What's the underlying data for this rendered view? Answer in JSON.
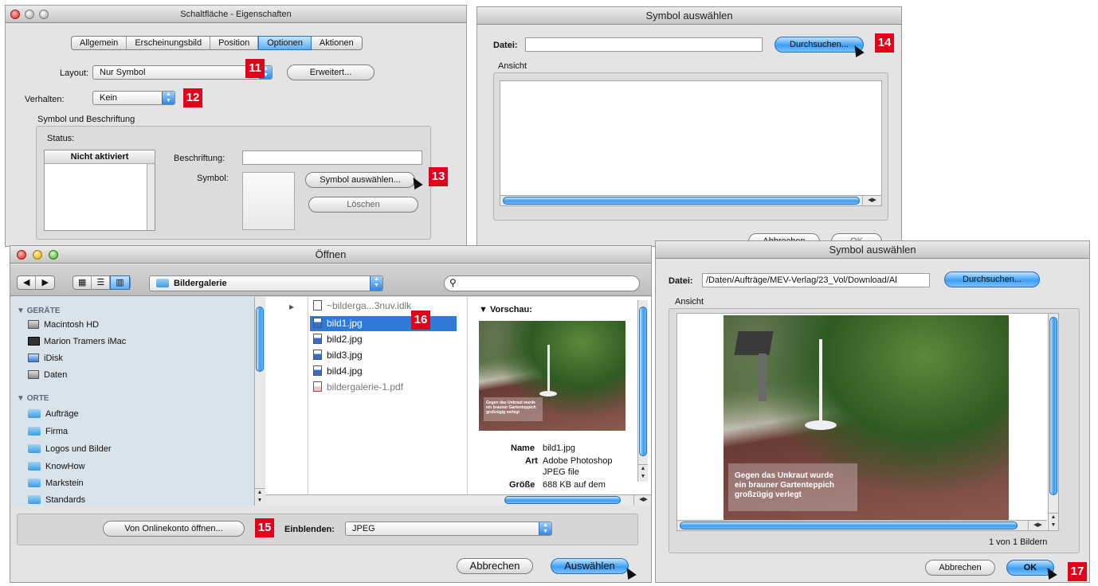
{
  "win_props": {
    "title": "Schaltfläche - Eigenschaften",
    "tabs": [
      "Allgemein",
      "Erscheinungsbild",
      "Position",
      "Optionen",
      "Aktionen"
    ],
    "selected_tab": "Optionen",
    "layout_label": "Layout:",
    "layout_value": "Nur Symbol",
    "erweitert_button": "Erweitert...",
    "verhalten_label": "Verhalten:",
    "verhalten_value": "Kein",
    "group_label": "Symbol und Beschriftung",
    "status_label": "Status:",
    "status_header": "Nicht aktiviert",
    "beschriftung_label": "Beschriftung:",
    "symbol_label": "Symbol:",
    "symbol_button": "Symbol auswählen...",
    "loeschen_button": "Löschen"
  },
  "win_symbol1": {
    "title": "Symbol auswählen",
    "datei_label": "Datei:",
    "browse_button": "Durchsuchen...",
    "ansicht_label": "Ansicht",
    "cancel_button": "Abbrechen",
    "ok_button": "OK"
  },
  "win_open": {
    "title": "Öffnen",
    "location": "Bildergalerie",
    "search_placeholder": "",
    "devices_header": "GERÄTE",
    "devices": [
      "Macintosh HD",
      "Marion Tramers iMac",
      "iDisk",
      "Daten"
    ],
    "places_header": "ORTE",
    "places": [
      "Aufträge",
      "Firma",
      "Logos und Bilder",
      "KnowHow",
      "Markstein",
      "Standards"
    ],
    "files": [
      "~bilderga...3nuv.idlk",
      "bild1.jpg",
      "bild2.jpg",
      "bild3.jpg",
      "bild4.jpg",
      "bildergalerie-1.pdf"
    ],
    "selected_file": "bild1.jpg",
    "preview_label": "Vorschau:",
    "info": {
      "name_label": "Name",
      "name_value": "bild1.jpg",
      "art_label": "Art",
      "art_value": "Adobe Photoshop",
      "art_value2": "JPEG file",
      "size_label": "Größe",
      "size_value": "688 KB auf dem"
    },
    "online_button": "Von Onlinekonto öffnen...",
    "einblenden_label": "Einblenden:",
    "einblenden_value": "JPEG",
    "cancel_button": "Abbrechen",
    "select_button": "Auswählen"
  },
  "win_symbol2": {
    "title": "Symbol auswählen",
    "datei_label": "Datei:",
    "datei_value": "/Daten/Aufträge/MEV-Verlag/23_Vol/Download/Al",
    "browse_button": "Durchsuchen...",
    "ansicht_label": "Ansicht",
    "count_text": "1 von 1 Bildern",
    "cancel_button": "Abbrechen",
    "ok_button": "OK"
  },
  "photo_caption": [
    "Gegen das Unkraut wurde",
    "ein brauner Gartenteppich",
    "großzügig verlegt"
  ],
  "badges": [
    "11",
    "12",
    "13",
    "14",
    "15",
    "16",
    "17"
  ],
  "colors": {
    "badge": "#e2001a",
    "aqua": "#3a9bf0",
    "sidebar": "#d9e3ec",
    "selection": "#2f7ad6"
  }
}
